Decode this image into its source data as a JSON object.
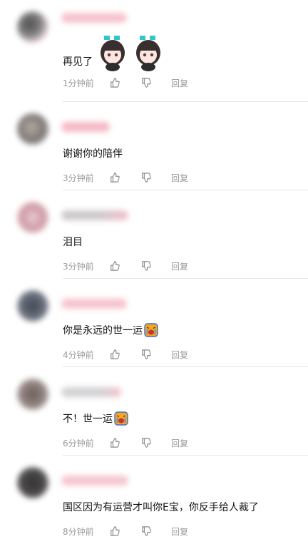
{
  "comments": [
    {
      "text": "再见了",
      "time": "1分钟前",
      "reply": "回复",
      "avatar_color": "#6b6b6b",
      "name_color": "#f6c3cc",
      "stickers": [
        "chibi-girl-sticker",
        "chibi-girl-sticker"
      ]
    },
    {
      "text": "谢谢你的陪伴",
      "time": "3分钟前",
      "reply": "回复",
      "avatar_color": "#7c7471",
      "name_color": "#f5b9c4"
    },
    {
      "text": "泪目",
      "time": "3分钟前",
      "reply": "回复",
      "avatar_color": "#d9a8b4",
      "name_color": "#d6d0d2"
    },
    {
      "text": "你是永远的世一运",
      "time": "4分钟前",
      "reply": "回复",
      "avatar_color": "#585e6c",
      "name_color": "#f5c4cd",
      "emoji": "crying-face-emoji"
    },
    {
      "text": "不！世一运",
      "time": "6分钟前",
      "reply": "回复",
      "avatar_color": "#7b6d6a",
      "name_color": "#d3d3d5",
      "emoji": "crying-face-emoji"
    },
    {
      "text": "国区因为有运营才叫你E宝，你反手给人裁了",
      "time": "8分钟前",
      "reply": "回复",
      "avatar_color": "#3a3838",
      "name_color": "#f5c6cf"
    }
  ]
}
